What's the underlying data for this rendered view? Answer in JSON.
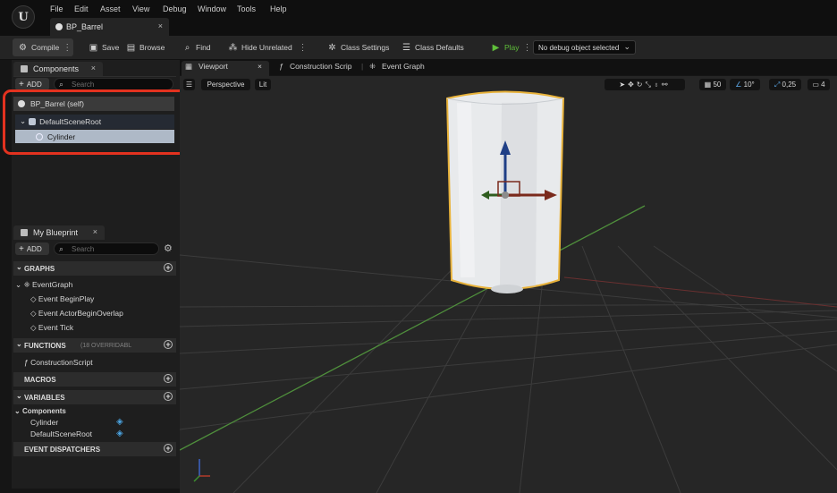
{
  "menu": [
    "File",
    "Edit",
    "Asset",
    "View",
    "Debug",
    "Window",
    "Tools",
    "Help"
  ],
  "logo": "U",
  "doc_tab": {
    "title": "BP_Barrel",
    "close": "×"
  },
  "toolbar": {
    "compile": "Compile",
    "save": "Save",
    "browse": "Browse",
    "find": "Find",
    "hide_unrelated": "Hide Unrelated",
    "class_settings": "Class Settings",
    "class_defaults": "Class Defaults",
    "play": "Play",
    "debug_object": "No debug object selected"
  },
  "components_panel": {
    "tab": "Components",
    "close": "×",
    "add": "ADD",
    "search_placeholder": "Search",
    "self": "BP_Barrel (self)",
    "root": "DefaultSceneRoot",
    "child": "Cylinder"
  },
  "blueprint_panel": {
    "tab": "My Blueprint",
    "close": "×",
    "add": "ADD",
    "search_placeholder": "Search",
    "graphs": "GRAPHS",
    "event_graph": "EventGraph",
    "events": [
      "Event BeginPlay",
      "Event ActorBeginOverlap",
      "Event Tick"
    ],
    "functions": "FUNCTIONS",
    "functions_note": "(18 OVERRIDABL",
    "construction_script": "ConstructionScript",
    "macros": "MACROS",
    "variables": "VARIABLES",
    "components_group": "Components",
    "var_items": [
      "Cylinder",
      "DefaultSceneRoot"
    ],
    "event_dispatchers": "EVENT DISPATCHERS"
  },
  "viewport_tabs": {
    "viewport": "Viewport",
    "close": "×",
    "construction": "Construction Scrip",
    "event_graph": "Event Graph"
  },
  "viewport_bar": {
    "perspective": "Perspective",
    "lit": "Lit",
    "grid_snap": "50",
    "rot_snap": "10°",
    "scale_snap": "0,25",
    "cam_speed": "4"
  },
  "colors": {
    "accent_highlight": "#e3321f",
    "selection": "#3a4f6a",
    "play_green": "#5fbf3a",
    "selected_outline": "#e8b23a"
  }
}
